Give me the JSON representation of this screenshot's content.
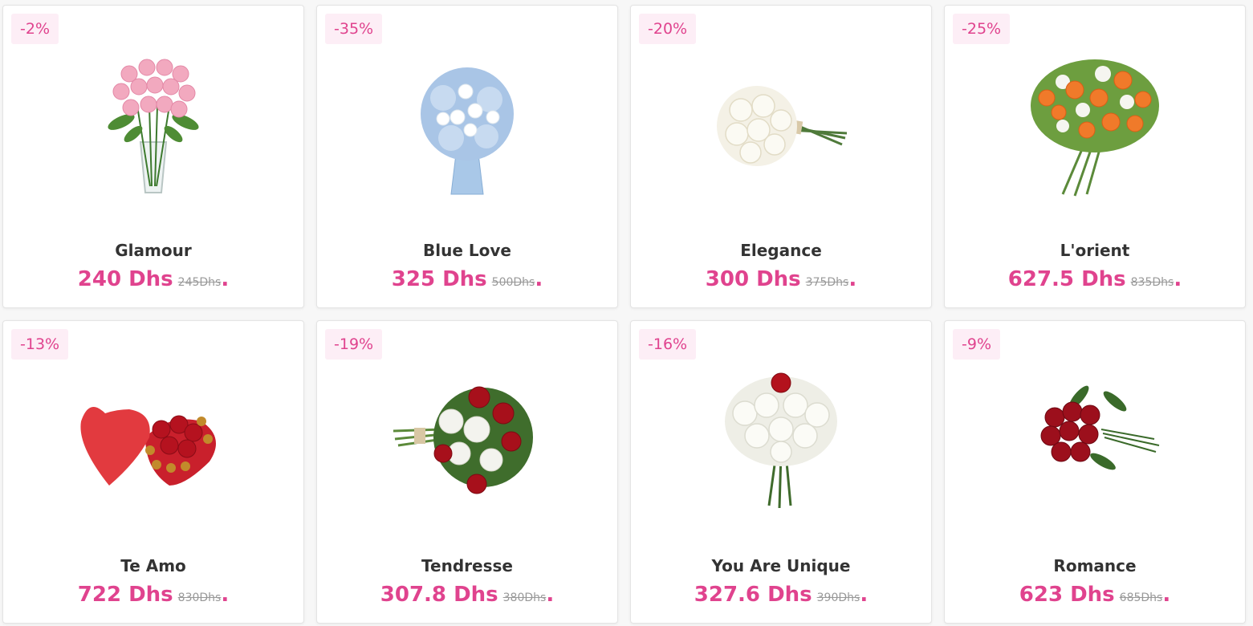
{
  "products": [
    {
      "badge": "-2%",
      "name": "Glamour",
      "price": "240 Dhs",
      "old_price": "245Dhs",
      "dot": ".",
      "image": "pink-roses-vase-image"
    },
    {
      "badge": "-35%",
      "name": "Blue Love",
      "price": "325 Dhs",
      "old_price": "500Dhs",
      "dot": ".",
      "image": "blue-hydrangea-bouquet-image"
    },
    {
      "badge": "-20%",
      "name": "Elegance",
      "price": "300 Dhs",
      "old_price": "375Dhs",
      "dot": ".",
      "image": "white-roses-bouquet-image"
    },
    {
      "badge": "-25%",
      "name": "L'orient",
      "price": "627.5 Dhs",
      "old_price": "835Dhs",
      "dot": ".",
      "image": "orange-white-bouquet-image"
    },
    {
      "badge": "-13%",
      "name": "Te Amo",
      "price": "722 Dhs",
      "old_price": "830Dhs",
      "dot": ".",
      "image": "heart-box-roses-chocolates-image"
    },
    {
      "badge": "-19%",
      "name": "Tendresse",
      "price": "307.8 Dhs",
      "old_price": "380Dhs",
      "dot": ".",
      "image": "red-white-bouquet-image"
    },
    {
      "badge": "-16%",
      "name": "You Are Unique",
      "price": "327.6 Dhs",
      "old_price": "390Dhs",
      "dot": ".",
      "image": "white-roses-red-rose-bouquet-image"
    },
    {
      "badge": "-9%",
      "name": "Romance",
      "price": "623 Dhs",
      "old_price": "685Dhs",
      "dot": ".",
      "image": "red-roses-bouquet-image"
    }
  ],
  "colors": {
    "accent": "#e0438e",
    "badge_bg": "#fdeef6",
    "title": "#333333",
    "old_price": "#999999"
  }
}
